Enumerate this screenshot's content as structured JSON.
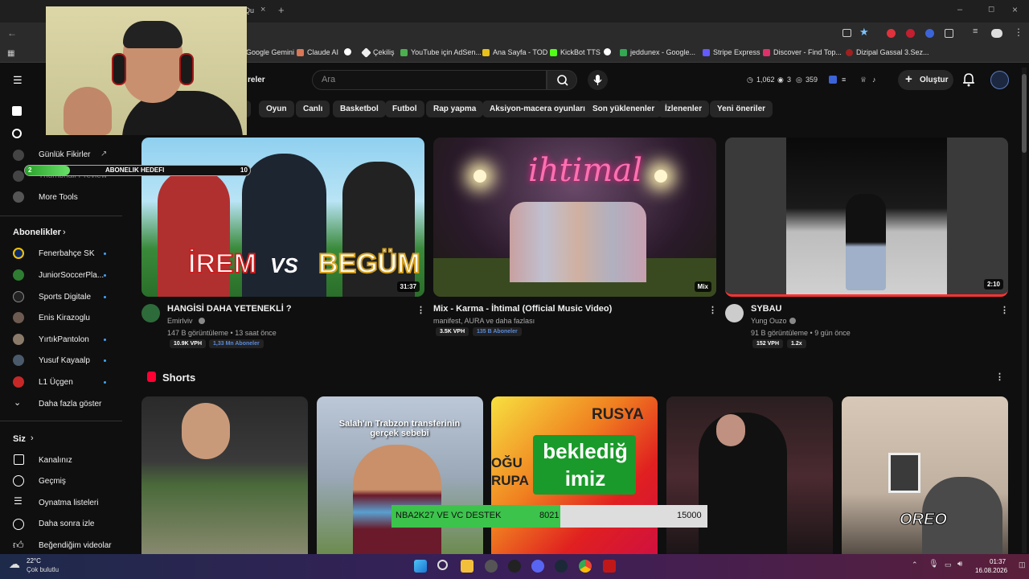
{
  "browser": {
    "tab_label": "Qu",
    "bookmarks": [
      "Google Gemini",
      "Claude AI",
      "Çekiliş",
      "YouTube için AdSen...",
      "Ana Sayfa - TOD",
      "KickBot TTS",
      "jeddunex - Google...",
      "Stripe Express",
      "Discover - Find Top...",
      "Dizipal Gassal 3.Sez..."
    ]
  },
  "header": {
    "search_placeholder": "Ara",
    "partial_tab": "reler",
    "stat_time": "1,062",
    "stat_views": "3",
    "stat_eye": "359",
    "create_label": "Oluştur"
  },
  "chips": [
    "Oyun",
    "Canlı",
    "Basketbol",
    "Futbol",
    "Rap yapma",
    "Aksiyon-macera oyunları",
    "Son yüklenenler",
    "İzlenenler",
    "Yeni öneriler"
  ],
  "sidebar": {
    "tools": [
      "Günlük Fikirler",
      "Thumbnail Preview",
      "More Tools"
    ],
    "subs_header": "Abonelikler",
    "subs": [
      "Fenerbahçe SK",
      "JuniorSoccerPla...",
      "Sports Digitale",
      "Enis Kirazoglu",
      "YırtıkPantolon",
      "Yusuf Kayaalp",
      "L1 Üçgen"
    ],
    "show_more": "Daha fazla göster",
    "you_header": "Siz",
    "you_items": [
      "Kanalınız",
      "Geçmiş",
      "Oynatma listeleri",
      "Daha sonra izle",
      "Beğendiğim videolar"
    ]
  },
  "videos": [
    {
      "title": "HANGİSİ DAHA YETENEKLİ ?",
      "channel": "Emirlviv",
      "meta": "147 B görüntüleme • 13 saat önce",
      "duration": "31:37",
      "badge1": "10.9K VPH",
      "badge2": "1,33 Mn Aboneler",
      "thumb_text_left": "İREM",
      "thumb_text_mid": "VS",
      "thumb_text_right": "BEGÜM"
    },
    {
      "title": "Mix - Karma - İhtimal (Official Music Video)",
      "channel": "manifest, AURA ve daha fazlası",
      "meta": "",
      "duration": "Mix",
      "badge1": "3.5K VPH",
      "badge2": "135 B Aboneler",
      "thumb_text": "ihtimal"
    },
    {
      "title": "SYBAU",
      "channel": "Yung Ouzo",
      "meta": "91 B görüntüleme • 9 gün önce",
      "duration": "2:10",
      "badge1": "152 VPH",
      "badge2": "1.2x"
    }
  ],
  "shorts": {
    "header": "Shorts",
    "items": [
      {
        "text": ""
      },
      {
        "text": "Salah'ın Trabzon transferinin gerçek sebebi"
      },
      {
        "text_top": "RUSYA",
        "text_side": "OĞU RUPA",
        "text_main": "beklediğ imiz"
      },
      {
        "text": ""
      },
      {
        "text": "OREO"
      }
    ]
  },
  "overlays": {
    "goal_label": "ABONELIK HEDEFI",
    "goal_current": "2",
    "goal_target": "10",
    "goal_fraction": 0.2,
    "destek_label": "NBA2K27 VE VC DESTEK",
    "destek_current": "8021",
    "destek_target": "15000",
    "destek_fraction": 0.535
  },
  "taskbar": {
    "weather_temp": "22°C",
    "weather_desc": "Çok bulutlu",
    "time": "01:37",
    "date": "16.08.2026"
  }
}
